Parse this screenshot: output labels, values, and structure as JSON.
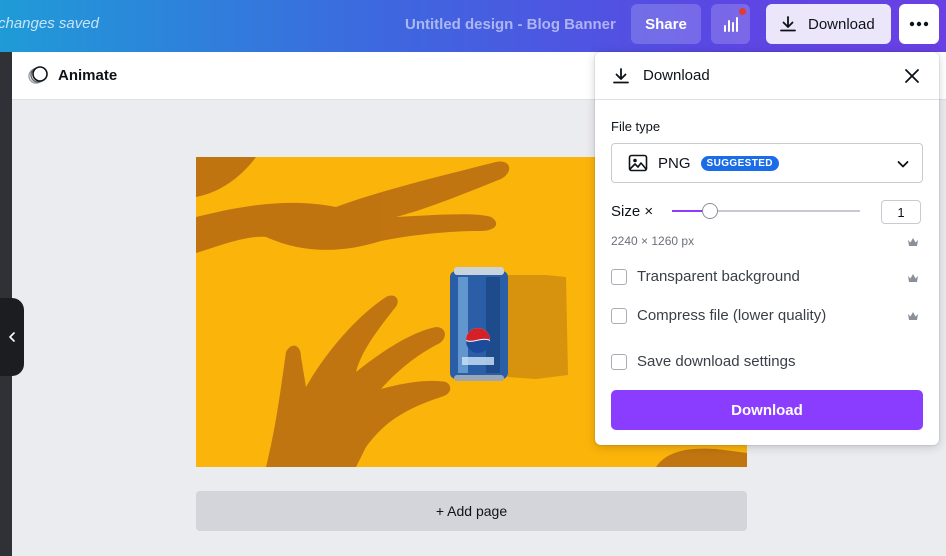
{
  "topbar": {
    "save_status": "changes saved",
    "document_title": "Untitled design - Blog Banner",
    "share_label": "Share",
    "download_label": "Download"
  },
  "editor": {
    "animate_label": "Animate",
    "add_page_label": "+ Add page"
  },
  "download_panel": {
    "title": "Download",
    "file_type_label": "File type",
    "file_type_value": "PNG",
    "file_type_badge": "SUGGESTED",
    "size_label": "Size ×",
    "size_value": "1",
    "size_fraction": 0.2,
    "dimensions": "2240 × 1260 px",
    "options": [
      {
        "label": "Transparent background",
        "checked": false,
        "premium": true
      },
      {
        "label": "Compress file (lower quality)",
        "checked": false,
        "premium": true
      },
      {
        "label": "Save download settings",
        "checked": false,
        "premium": false
      }
    ],
    "download_button_label": "Download"
  },
  "colors": {
    "accent": "#8b3dff",
    "badge": "#1a6ce8",
    "canvas_bg": "#fbb40a"
  }
}
